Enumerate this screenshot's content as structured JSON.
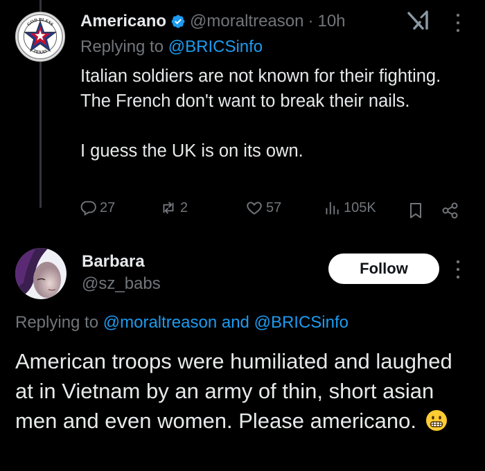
{
  "tweet1": {
    "name": "Americano",
    "handle": "@moraltreason",
    "separator": "·",
    "time": "10h",
    "replying_prefix": "Replying to ",
    "replying_to": "@BRICSinfo",
    "body": [
      "Italian soldiers are not known for their fighting. The French don't want to break their nails.",
      "I guess the UK is on its own."
    ],
    "actions": {
      "replies": "27",
      "reposts": "2",
      "likes": "57",
      "views": "105K"
    },
    "avatar_text": [
      "GOD BLESS",
      "TEXAS"
    ]
  },
  "tweet2": {
    "name": "Barbara",
    "handle": "@sz_babs",
    "follow_label": "Follow",
    "replying_prefix": "Replying to ",
    "replying_to_1": "@moraltreason",
    "replying_and": " and ",
    "replying_to_2": "@BRICSinfo",
    "body": "American troops were humiliated and laughed at in Vietnam by an army of thin, short asian men and even women. Please americano.",
    "emoji": "grimacing-face"
  },
  "colors": {
    "background": "#000000",
    "text": "#e7e9ea",
    "muted": "#71767b",
    "link": "#1d9bf0",
    "verified": "#1d9bf0"
  }
}
